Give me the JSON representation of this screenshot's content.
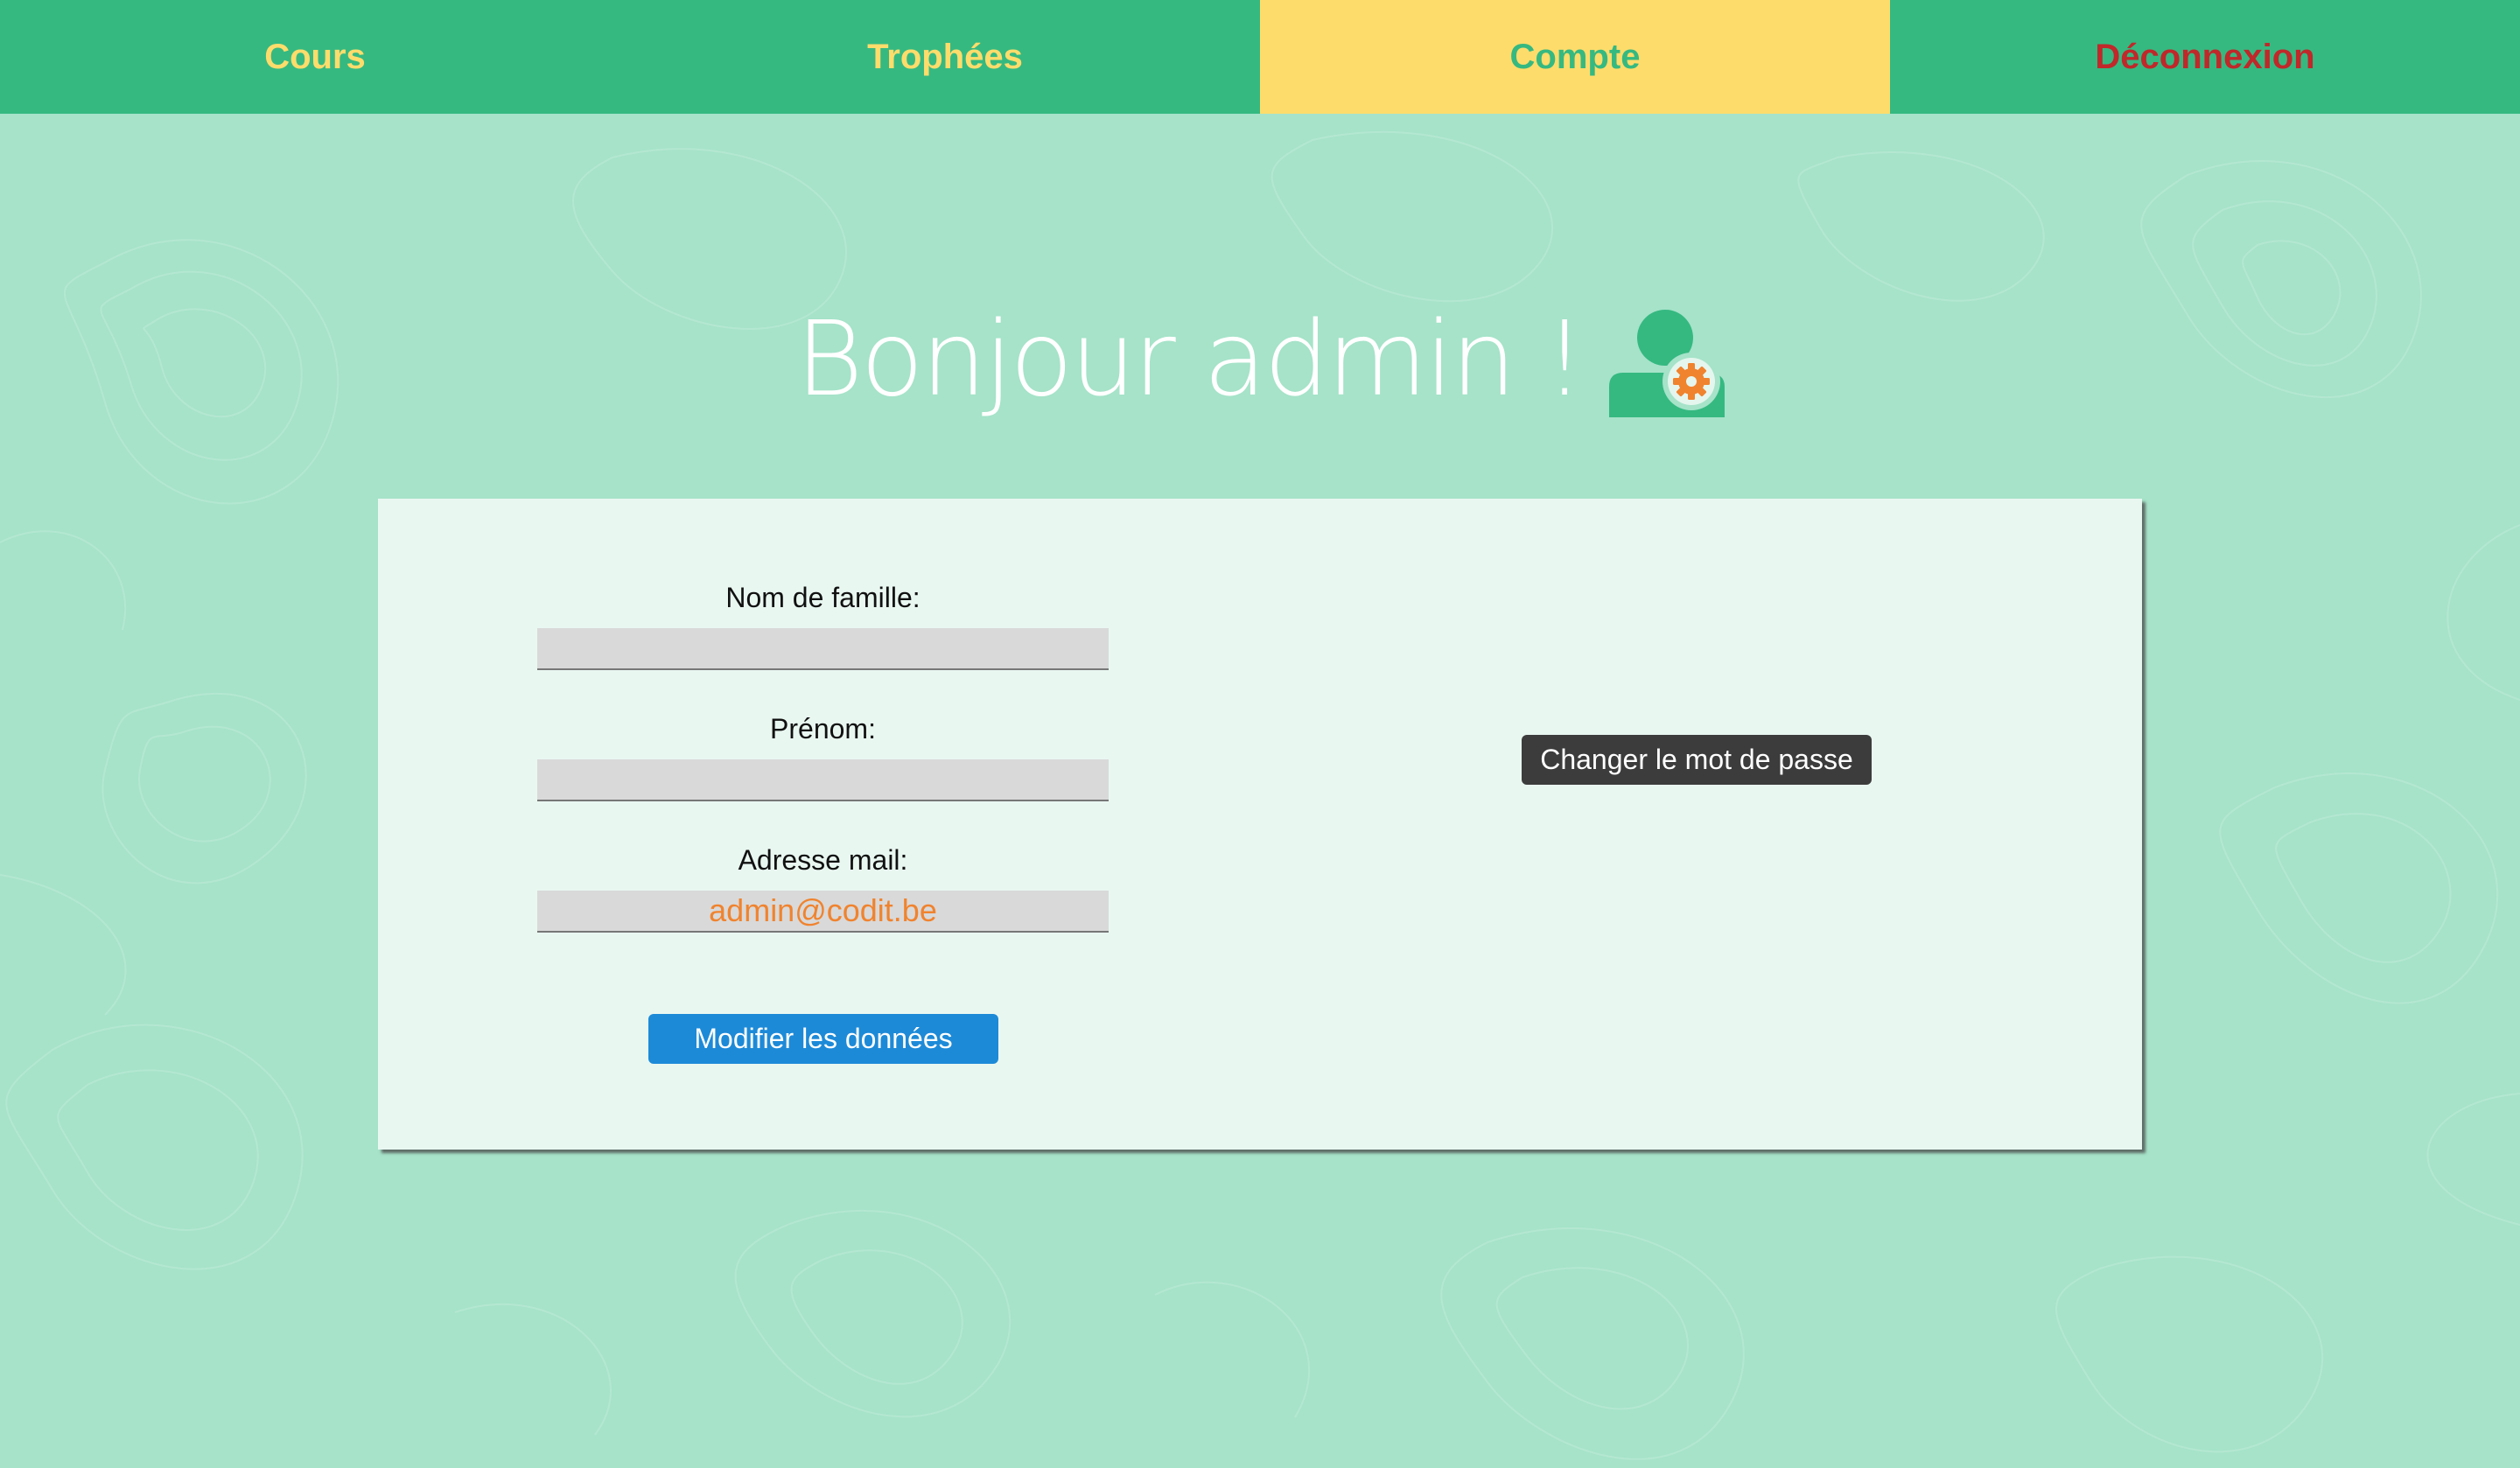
{
  "nav": {
    "items": [
      {
        "label": "Cours"
      },
      {
        "label": "Trophées"
      },
      {
        "label": "Compte"
      },
      {
        "label": "Déconnexion"
      }
    ],
    "active": "Compte"
  },
  "greeting": {
    "text": "Bonjour admin !",
    "icon": "admin-settings-icon"
  },
  "form": {
    "lastname": {
      "label": "Nom de famille:",
      "value": ""
    },
    "firstname": {
      "label": "Prénom:",
      "value": ""
    },
    "email": {
      "label": "Adresse mail:",
      "value": "admin@codit.be"
    },
    "submit_label": "Modifier les données"
  },
  "password": {
    "button_label": "Changer le mot de passe"
  },
  "colors": {
    "nav_green": "#35b981",
    "accent_yellow": "#fedc6b",
    "logout_red": "#c0282a",
    "background": "#a6e3c9",
    "card": "#e9f7f1",
    "email_text": "#f0832e",
    "submit_blue": "#1d8ad8",
    "password_dark": "#3c3c3c"
  }
}
